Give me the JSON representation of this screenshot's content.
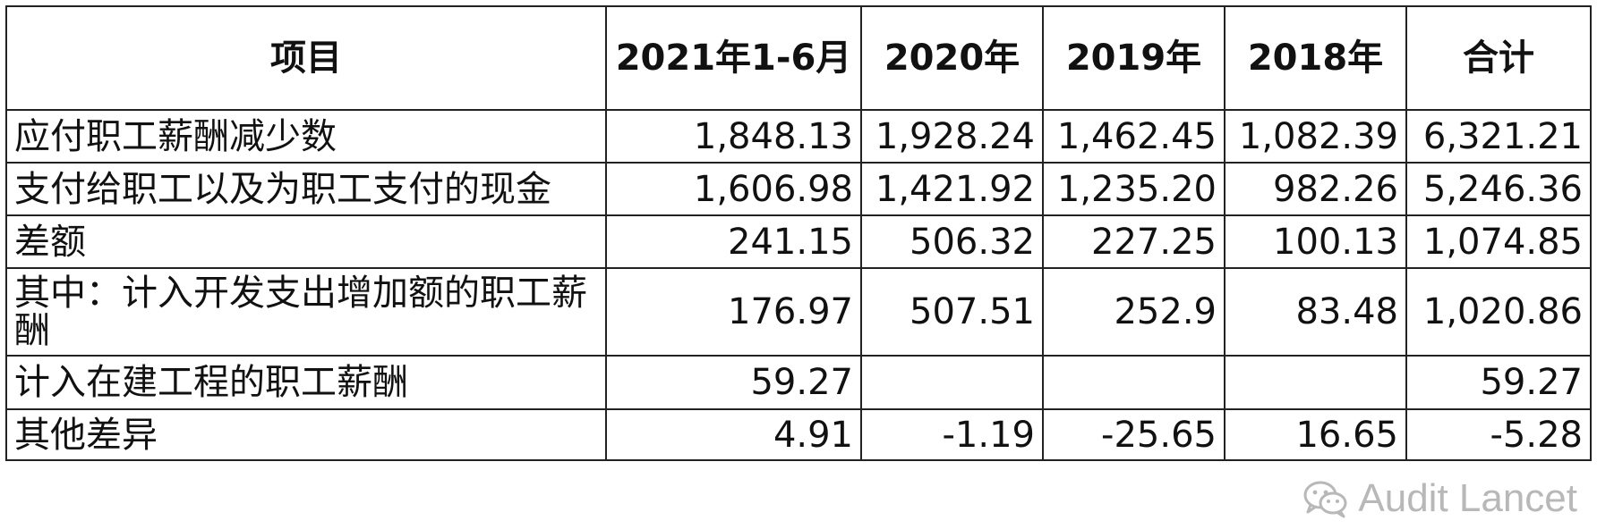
{
  "table": {
    "headers": [
      "项目",
      "2021年1-6月",
      "2020年",
      "2019年",
      "2018年",
      "合计"
    ],
    "rows": [
      {
        "label": "应付职工薪酬减少数",
        "values": [
          "1,848.13",
          "1,928.24",
          "1,462.45",
          "1,082.39",
          "6,321.21"
        ]
      },
      {
        "label": "支付给职工以及为职工支付的现金",
        "values": [
          "1,606.98",
          "1,421.92",
          "1,235.20",
          "982.26",
          "5,246.36"
        ]
      },
      {
        "label": "差额",
        "values": [
          "241.15",
          "506.32",
          "227.25",
          "100.13",
          "1,074.85"
        ]
      },
      {
        "label": "其中：计入开发支出增加额的职工薪酬",
        "values": [
          "176.97",
          "507.51",
          "252.9",
          "83.48",
          "1,020.86"
        ]
      },
      {
        "label": "计入在建工程的职工薪酬",
        "values": [
          "59.27",
          "",
          "",
          "",
          "59.27"
        ]
      },
      {
        "label": "其他差异",
        "values": [
          "4.91",
          "-1.19",
          "-25.65",
          "16.65",
          "-5.28"
        ]
      }
    ]
  },
  "watermark": {
    "icon": "wechat-icon",
    "text": "Audit Lancet"
  }
}
